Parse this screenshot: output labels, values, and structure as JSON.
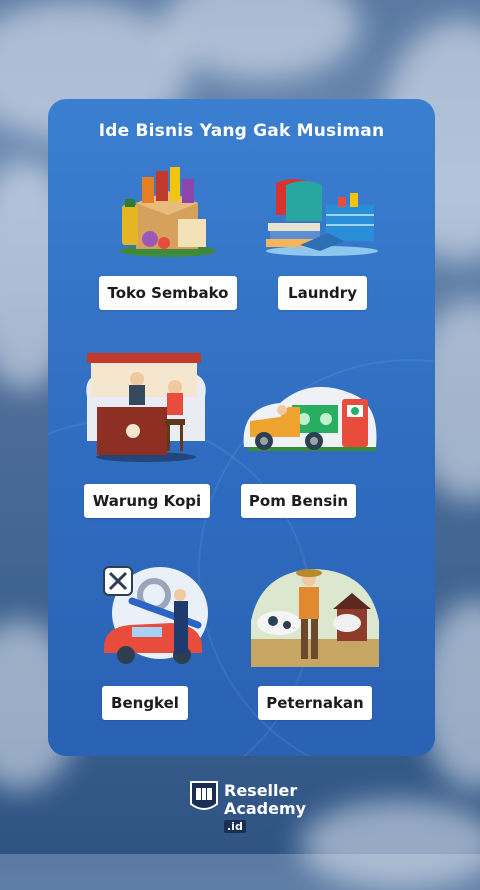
{
  "card": {
    "title": "Ide Bisnis Yang Gak Musiman"
  },
  "items": [
    {
      "label": "Toko Sembako",
      "icon": "grocery-basket-icon"
    },
    {
      "label": "Laundry",
      "icon": "laundry-basket-icon"
    },
    {
      "label": "Warung Kopi",
      "icon": "coffee-stall-icon"
    },
    {
      "label": "Pom Bensin",
      "icon": "gas-station-icon"
    },
    {
      "label": "Bengkel",
      "icon": "car-repair-icon"
    },
    {
      "label": "Peternakan",
      "icon": "farmer-icon"
    }
  ],
  "brand": {
    "line1": "Reseller",
    "line2": "Academy",
    "suffix": ".id"
  },
  "colors": {
    "card": "#2f6cc0",
    "label_bg": "#ffffff",
    "text": "#1c1c1c"
  }
}
